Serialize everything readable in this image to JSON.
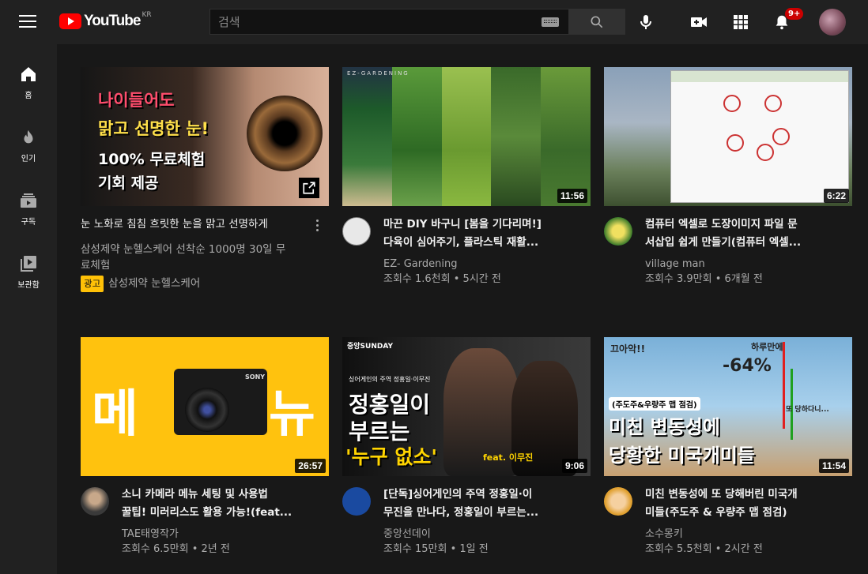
{
  "header": {
    "logo_text": "YouTube",
    "region": "KR",
    "search_placeholder": "검색",
    "notifications_badge": "9+"
  },
  "sidenav": {
    "items": [
      {
        "label": "홈",
        "icon": "home-icon"
      },
      {
        "label": "인기",
        "icon": "fire-icon"
      },
      {
        "label": "구독",
        "icon": "subscriptions-icon"
      },
      {
        "label": "보관함",
        "icon": "library-icon"
      }
    ]
  },
  "videos": [
    {
      "title_line1": "눈 노화로 침침 흐릿한 눈을 맑고 선명하게",
      "desc_line1": "삼성제약 눈헬스케어 선착순 1000명 30일 무",
      "desc_line2": "료체험",
      "ad_label": "광고",
      "advertiser": "삼성제약 눈헬스케어",
      "thumb_text": [
        "나이들어도",
        "맑고 선명한 눈!",
        "100% 무료체험",
        "기회 제공"
      ]
    },
    {
      "title_line1": "마끈 DIY 바구니 [봄을 기다리며!]",
      "title_line2": "다육이 심어주기, 플라스틱 재활...",
      "channel": "EZ- Gardening",
      "stats": "조회수 1.6천회 • 5시간 전",
      "duration": "11:56",
      "thumb_text": "EZ-GARDENING"
    },
    {
      "title_line1": "컴퓨터 엑셀로 도장이미지 파일 문",
      "title_line2": "서삽입 쉽게 만들기(컴퓨터 엑셀...",
      "channel": "village man",
      "stats": "조회수 3.9만회 • 6개월 전",
      "duration": "6:22"
    },
    {
      "title_line1": "소니 카메라 메뉴 세팅 및 사용법",
      "title_line2": "꿀팁! 미러리스도 활용 가능!(feat...",
      "channel": "TAE태영작가",
      "stats": "조회수 6.5만회 • 2년 전",
      "duration": "26:57",
      "thumb_left": "메",
      "thumb_right": "뉴",
      "thumb_brand": "SONY"
    },
    {
      "title_line1": "[단독]싱어게인의 주역 정홍일·이",
      "title_line2": "무진을 만나다, 정홍일이 부르는...",
      "channel": "중앙선데이",
      "stats": "조회수 15만회 • 1일 전",
      "duration": "9:06",
      "thumb_brand": "중앙SUNDAY",
      "thumb_sub": "싱어게인의 주역 정홍일·이무진",
      "thumb_big1": "정홍일이",
      "thumb_big2": "부르는",
      "thumb_big3": "'누구 없소'",
      "thumb_feat": "feat. 이무진"
    },
    {
      "title_line1": "미친 변동성에 또 당해버린 미국개",
      "title_line2": "미들(주도주 & 우량주 맵 점검)",
      "channel": "소수몽키",
      "stats": "조회수 5.5천회 • 2시간 전",
      "duration": "11:54",
      "thumb_top1": "끄아악!!",
      "thumb_top2": "하루만에",
      "thumb_pct": "-64%",
      "thumb_sub": "(주도주&우량주 맵 점검)",
      "thumb_big1": "미친 변동성에",
      "thumb_big2": "당황한 미국개미들",
      "thumb_side": "또 당하다니..."
    }
  ],
  "colors": {
    "background": "#181818",
    "topbar": "#212121",
    "accent_red": "#ff0000",
    "ad_badge": "#ffc107",
    "meta_text": "#aaaaaa"
  }
}
